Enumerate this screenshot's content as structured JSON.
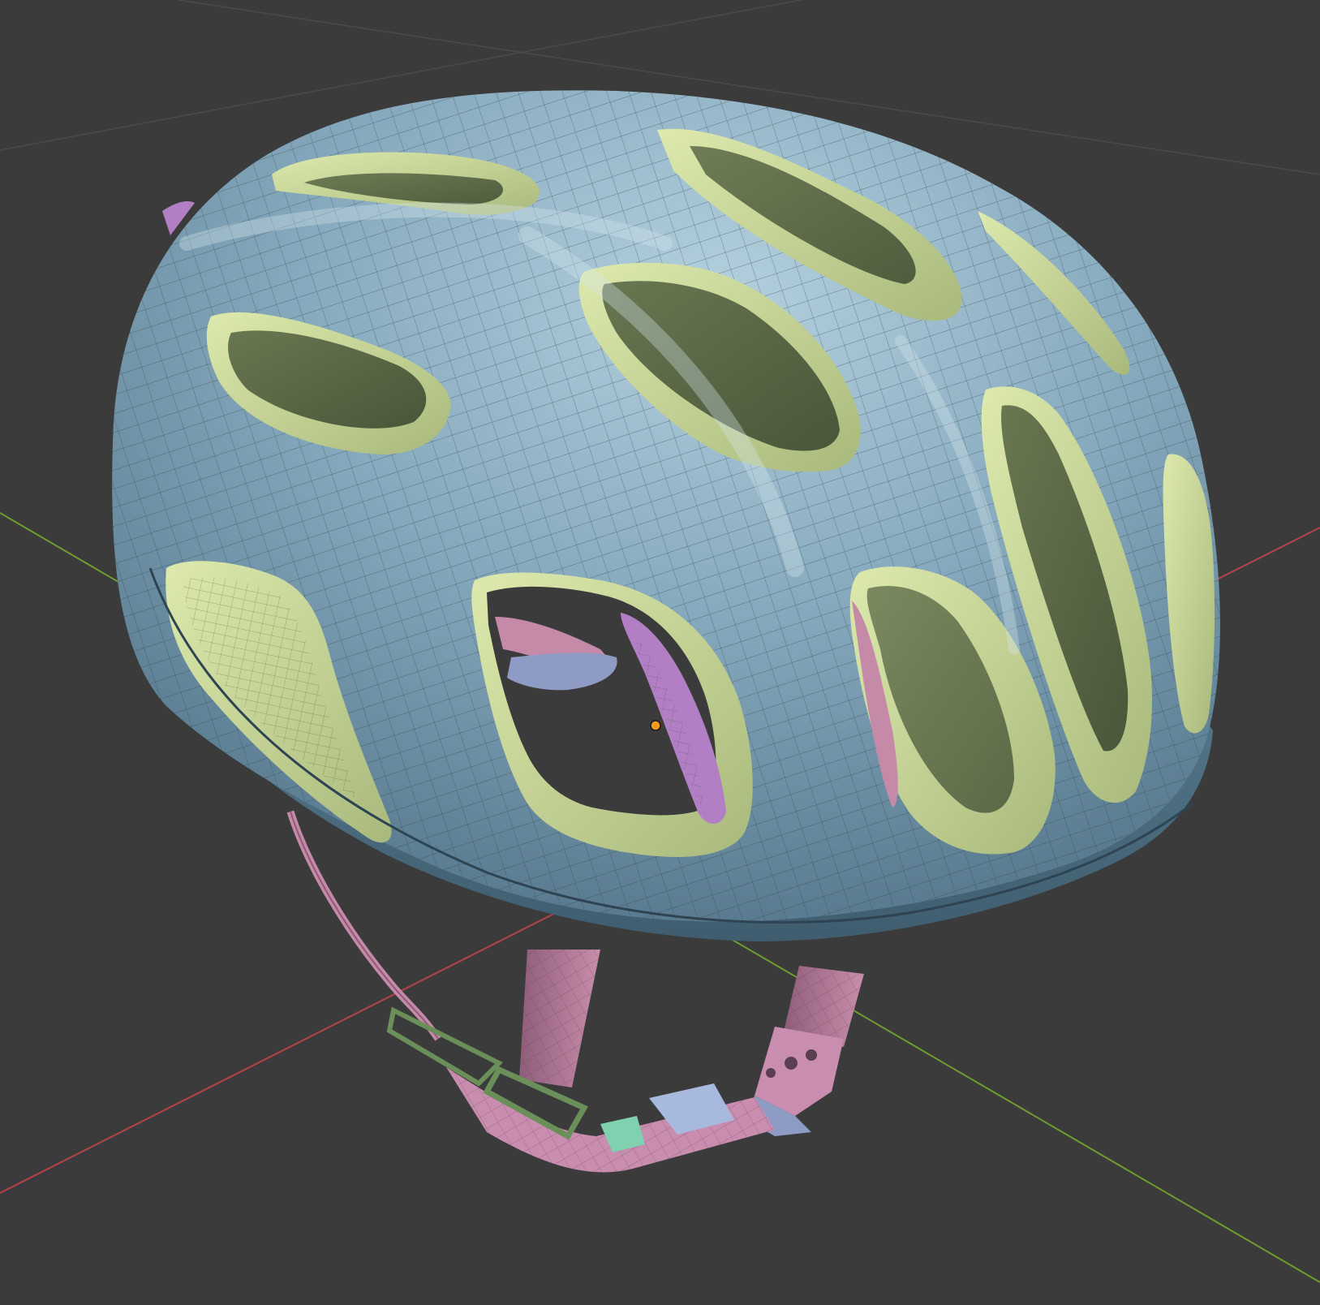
{
  "viewport": {
    "background_color": "#3b3b3b",
    "grid_line_color": "#545454",
    "x_axis_color": "#b5434b",
    "y_axis_color": "#6f9b2f",
    "origin_marker_color": "#f39a1e"
  },
  "model": {
    "shell_color": "#7fa3b8",
    "shell_dark_color": "#55788c",
    "shell_light_color": "#a9c6d6",
    "vent_inner_color": "#c9d89a",
    "vent_deep_color": "#4f5d3f",
    "strap_color": "#c58aa8",
    "strap_dark_color": "#8e5b78",
    "buckle_color": "#a8b9de",
    "buckle_accent_color": "#7fd1b0",
    "pad_color": "#b27fc4",
    "wire_color": "#26333b"
  },
  "icons": {
    "object_origin": "origin-dot-icon"
  }
}
